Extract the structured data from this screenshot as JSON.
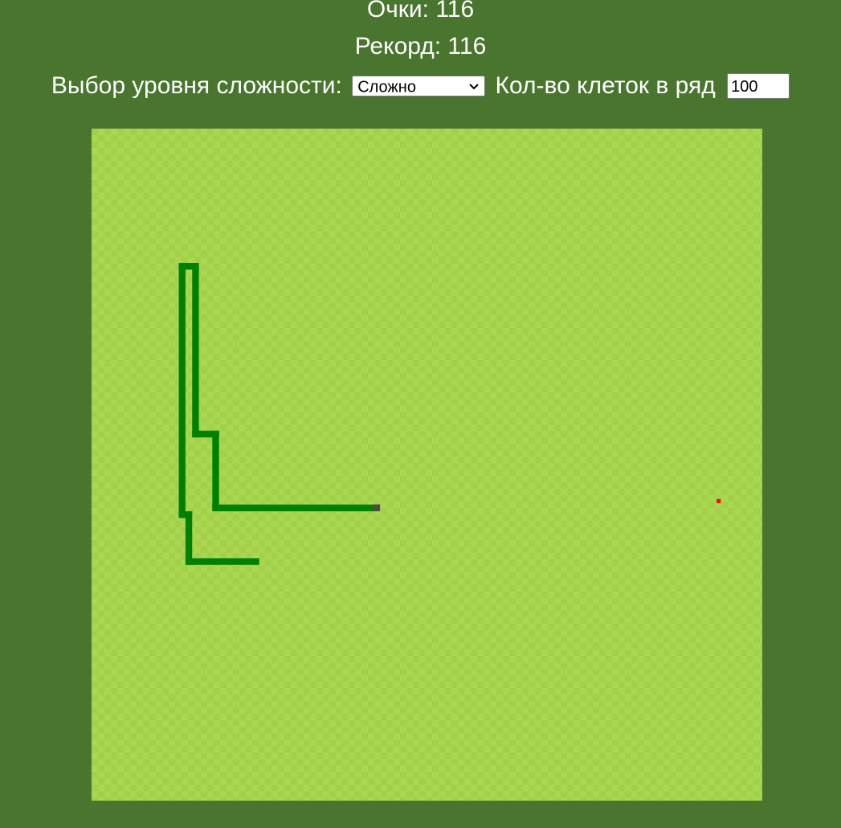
{
  "score": {
    "label": "Очки: 116"
  },
  "record": {
    "label": "Рекорд: 116"
  },
  "difficulty": {
    "label": "Выбор уровня сложности:",
    "selected": "Сложно"
  },
  "cells": {
    "label": "Кол-во клеток в ряд",
    "value": "100"
  },
  "game": {
    "grid_size": 100,
    "snake_head": [
      42,
      56
    ],
    "food": [
      93,
      55
    ],
    "snake_path": [
      [
        42,
        56
      ],
      [
        18,
        56
      ],
      [
        18,
        45
      ],
      [
        15,
        45
      ],
      [
        15,
        20
      ],
      [
        13,
        20
      ],
      [
        13,
        57
      ],
      [
        14,
        57
      ],
      [
        14,
        64
      ],
      [
        24,
        64
      ]
    ],
    "colors": {
      "background": "#4a752f",
      "board_light": "#aad751",
      "board_dark": "#a2d149",
      "snake_body": "#008000",
      "snake_head": "#4a4a4a",
      "food": "#ff0000"
    }
  }
}
